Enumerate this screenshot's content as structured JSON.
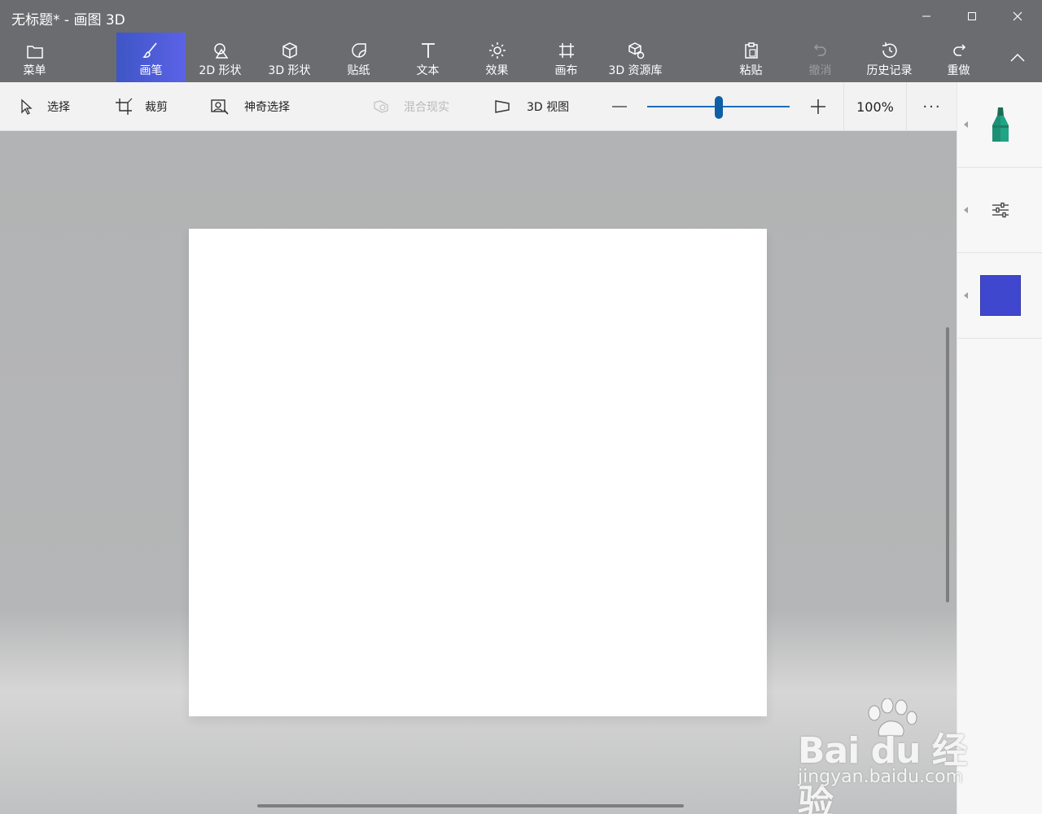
{
  "window": {
    "title": "无标题* - 画图 3D"
  },
  "ribbon": {
    "items": [
      {
        "label": "菜单",
        "icon": "folder-icon"
      },
      {
        "label": "画笔",
        "icon": "brush-icon",
        "active": true
      },
      {
        "label": "2D 形状",
        "icon": "shapes-2d-icon"
      },
      {
        "label": "3D 形状",
        "icon": "cube-icon"
      },
      {
        "label": "贴纸",
        "icon": "sticker-icon"
      },
      {
        "label": "文本",
        "icon": "text-icon"
      },
      {
        "label": "效果",
        "icon": "sun-icon"
      },
      {
        "label": "画布",
        "icon": "canvas-icon"
      },
      {
        "label": "3D 资源库",
        "icon": "library-icon"
      },
      {
        "label": "粘贴",
        "icon": "paste-icon"
      },
      {
        "label": "撤消",
        "icon": "undo-icon",
        "disabled": true
      },
      {
        "label": "历史记录",
        "icon": "history-icon"
      },
      {
        "label": "重做",
        "icon": "redo-icon"
      }
    ],
    "active_color": "#4c5ad8"
  },
  "toolbar": {
    "select_label": "选择",
    "crop_label": "裁剪",
    "magic_select_label": "神奇选择",
    "mixed_reality_label": "混合现实",
    "view3d_label": "3D 视图",
    "zoom_value": "100%",
    "more_label": "···"
  },
  "sidepanel": {
    "tool_icon": "marker-icon",
    "settings_icon": "sliders-icon",
    "selected_color": "#4047cf"
  },
  "watermark": {
    "logo_text": "Bai du 经验",
    "sub_text": "jingyan.baidu.com"
  }
}
